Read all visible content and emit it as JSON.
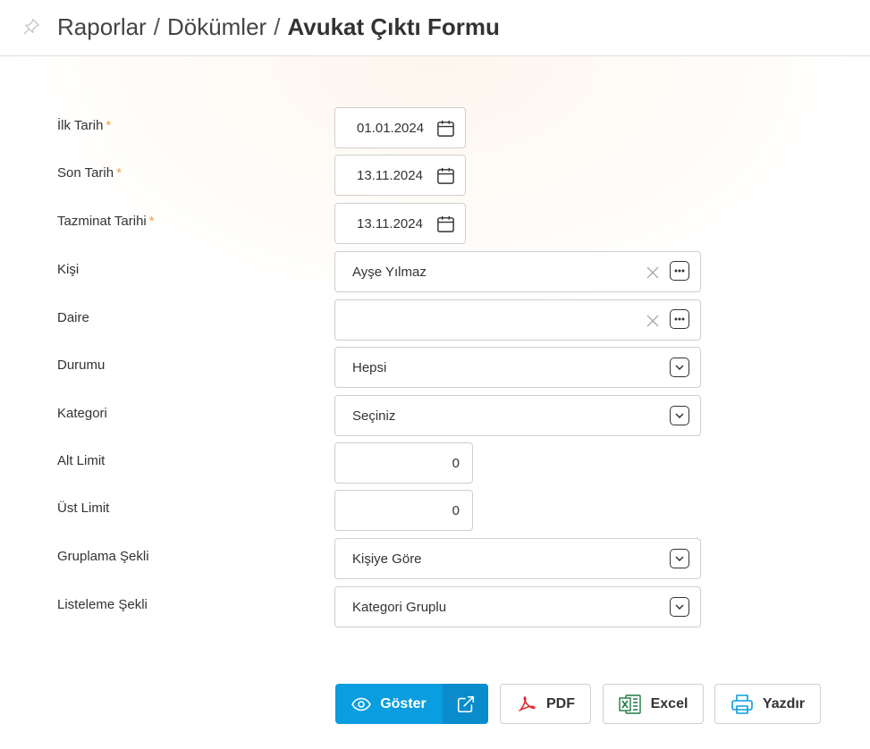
{
  "header": {
    "crumbs": [
      "Raporlar",
      "Dökümler"
    ],
    "separator": "/",
    "current": "Avukat Çıktı Formu"
  },
  "form": {
    "required_mark": "*",
    "start_date": {
      "label": "İlk Tarih",
      "value": "01.01.2024"
    },
    "end_date": {
      "label": "Son Tarih",
      "value": "13.11.2024"
    },
    "compensation_date": {
      "label": "Tazminat Tarihi",
      "value": "13.11.2024"
    },
    "person": {
      "label": "Kişi",
      "value": "Ayşe Yılmaz"
    },
    "apartment": {
      "label": "Daire",
      "value": ""
    },
    "status": {
      "label": "Durumu",
      "value": "Hepsi"
    },
    "category": {
      "label": "Kategori",
      "value": "Seçiniz"
    },
    "lower_limit": {
      "label": "Alt Limit",
      "value": "0"
    },
    "upper_limit": {
      "label": "Üst Limit",
      "value": "0"
    },
    "grouping": {
      "label": "Gruplama Şekli",
      "value": "Kişiye Göre"
    },
    "listing": {
      "label": "Listeleme Şekli",
      "value": "Kategori Gruplu"
    }
  },
  "actions": {
    "show": "Göster",
    "pdf": "PDF",
    "excel": "Excel",
    "print": "Yazdır"
  },
  "colors": {
    "primary": "#0a9ddf",
    "required": "#f0a23b",
    "pdf_red": "#d9252a",
    "excel_green": "#1d7a45",
    "print_blue": "#0a9ddf"
  }
}
